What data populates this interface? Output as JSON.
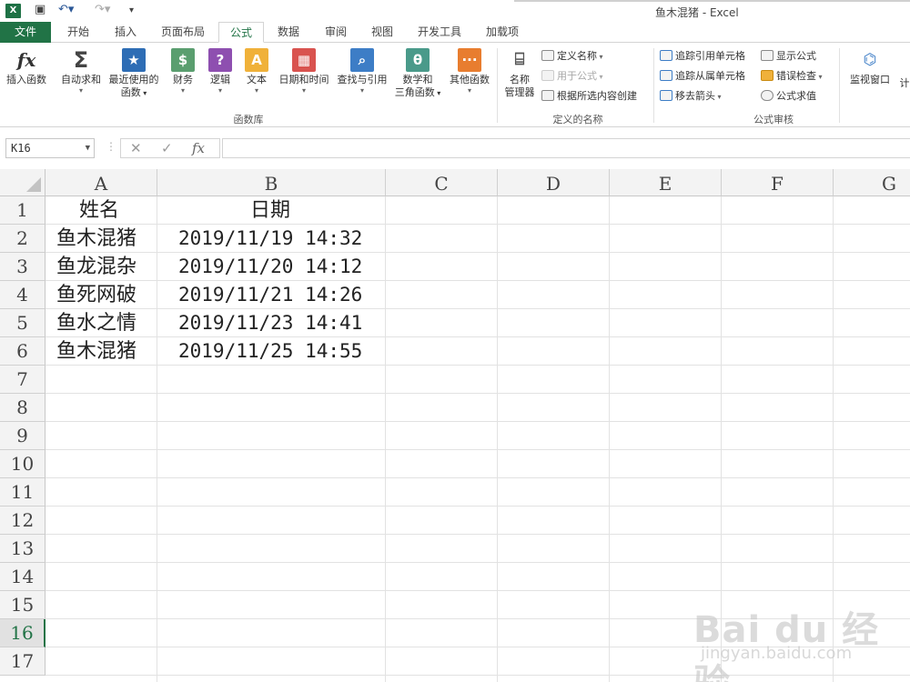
{
  "window": {
    "title": "鱼木混猪 - Excel",
    "app_icon": "excel-logo-icon"
  },
  "qat": {
    "save_icon": "save-icon",
    "undo_icon": "undo-icon",
    "redo_icon": "redo-icon",
    "customize_icon": "customize-qat-icon"
  },
  "tabs": [
    {
      "label": "文件"
    },
    {
      "label": "开始"
    },
    {
      "label": "插入"
    },
    {
      "label": "页面布局"
    },
    {
      "label": "公式"
    },
    {
      "label": "数据"
    },
    {
      "label": "审阅"
    },
    {
      "label": "视图"
    },
    {
      "label": "开发工具"
    },
    {
      "label": "加载项"
    }
  ],
  "ribbon": {
    "function_library": {
      "group_label": "函数库",
      "insert_function": "插入函数",
      "autosum": "自动求和",
      "recent_1": "最近使用的",
      "recent_2": "函数",
      "financial": "财务",
      "logical": "逻辑",
      "text": "文本",
      "datetime": "日期和时间",
      "lookup": "查找与引用",
      "math_1": "数学和",
      "math_2": "三角函数",
      "more": "其他函数"
    },
    "defined_names": {
      "group_label": "定义的名称",
      "name_manager_1": "名称",
      "name_manager_2": "管理器",
      "define_name": "定义名称",
      "use_in_formula": "用于公式",
      "create_from_selection": "根据所选内容创建"
    },
    "formula_auditing": {
      "group_label": "公式审核",
      "trace_precedents": "追踪引用单元格",
      "trace_dependents": "追踪从属单元格",
      "remove_arrows": "移去箭头",
      "show_formulas": "显示公式",
      "error_checking": "错误检查",
      "evaluate_formula": "公式求值",
      "watch_window": "监视窗口",
      "calc_partial": "计"
    }
  },
  "formula_bar": {
    "name_box": "K16",
    "cancel": "✕",
    "enter": "✓",
    "fx": "fx",
    "content": ""
  },
  "columns": [
    "A",
    "B",
    "C",
    "D",
    "E",
    "F",
    "G"
  ],
  "rows": [
    "1",
    "2",
    "3",
    "4",
    "5",
    "6",
    "7",
    "8",
    "9",
    "10",
    "11",
    "12",
    "13",
    "14",
    "15",
    "16",
    "17"
  ],
  "selected_row": "16",
  "cells": {
    "A1": "姓名",
    "B1": "日期",
    "A2": "鱼木混猪",
    "B2": "2019/11/19 14:32",
    "A3": "鱼龙混杂",
    "B3": "2019/11/20 14:12",
    "A4": "鱼死网破",
    "B4": "2019/11/21 14:26",
    "A5": "鱼水之情",
    "B5": "2019/11/23 14:41",
    "A6": "鱼木混猪",
    "B6": "2019/11/25 14:55"
  },
  "watermark": {
    "logo": "Bai du 经验",
    "url": "jingyan.baidu.com"
  }
}
